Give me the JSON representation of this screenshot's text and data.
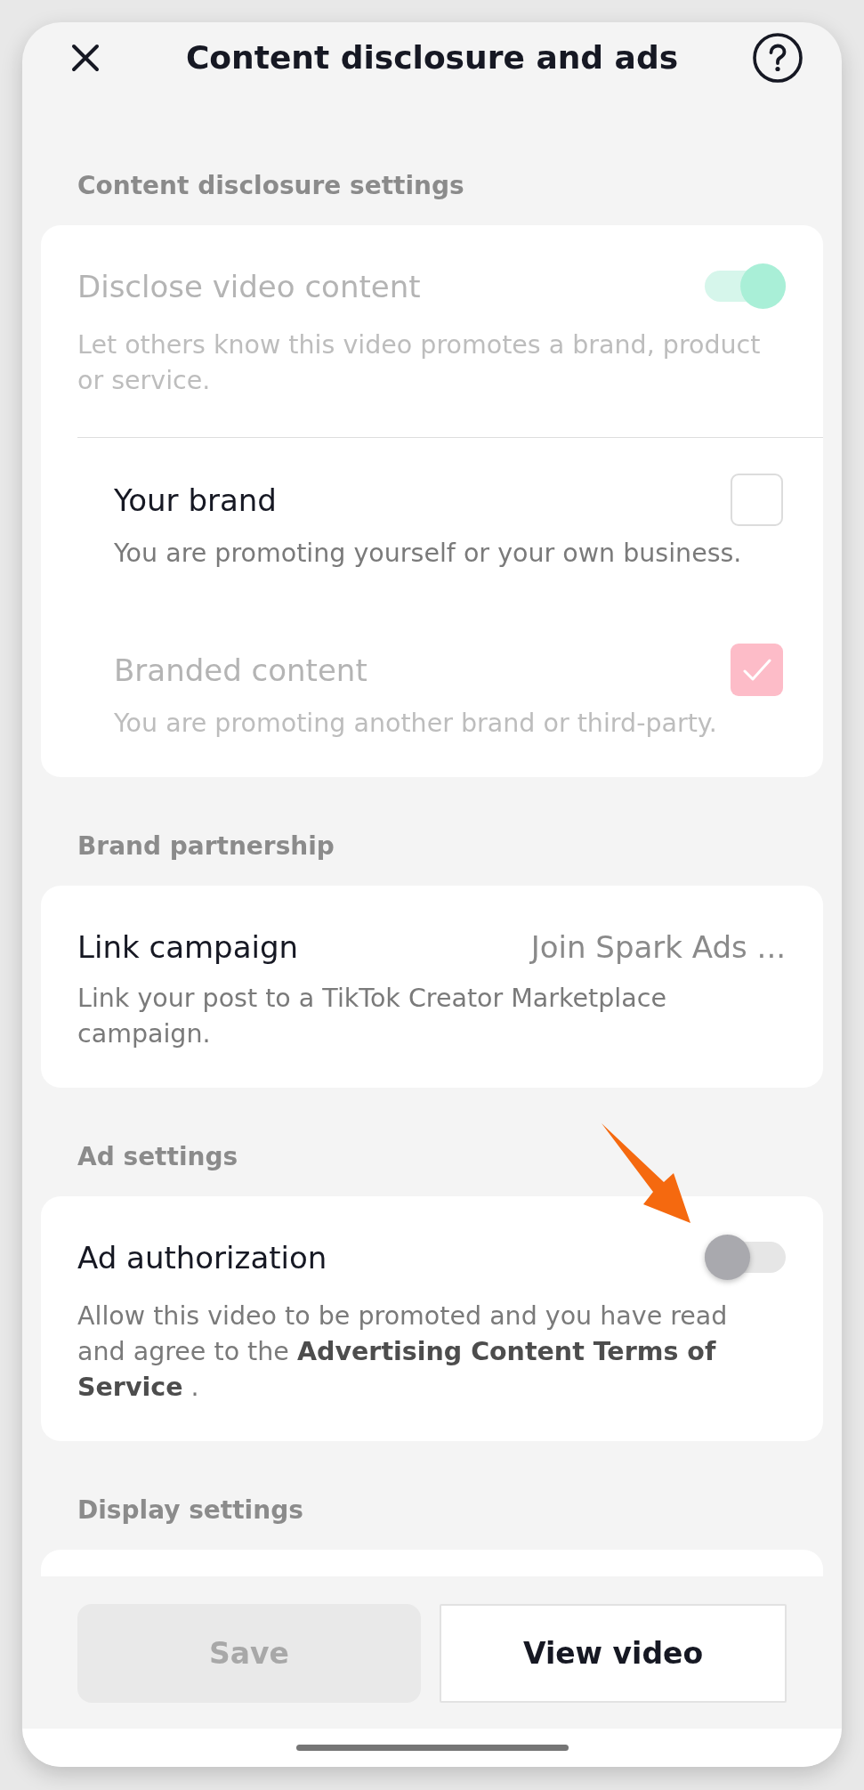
{
  "header": {
    "title": "Content disclosure and ads"
  },
  "sections": [
    {
      "title": "Content disclosure settings",
      "items": [
        {
          "kind": "toggle",
          "label": "Disclose video content",
          "description": "Let others know this video promotes a brand, product or service.",
          "on": true,
          "disabled": true,
          "children": [
            {
              "kind": "checkbox",
              "label": "Your brand",
              "description": "You are promoting yourself or your own business.",
              "checked": false,
              "disabled": false
            },
            {
              "kind": "checkbox",
              "label": "Branded content",
              "description": "You are promoting another brand or third-party.",
              "checked": true,
              "disabled": true
            }
          ]
        }
      ]
    },
    {
      "title": "Brand partnership",
      "items": [
        {
          "kind": "link",
          "label": "Link campaign",
          "value": "Join Spark Ads ...",
          "description": "Link your post to a TikTok Creator Marketplace campaign."
        }
      ]
    },
    {
      "title": "Ad settings",
      "items": [
        {
          "kind": "toggle",
          "label": "Ad authorization",
          "description": "Allow this video to be promoted and you have read and agree to the **Advertising Content Terms of Service** .",
          "on": false,
          "disabled": false
        }
      ]
    },
    {
      "title": "Display settings"
    }
  ],
  "buttons": [
    {
      "kind": "primary",
      "label": "Save",
      "disabled": true
    },
    {
      "kind": "secondary",
      "label": "View video",
      "disabled": false
    }
  ]
}
